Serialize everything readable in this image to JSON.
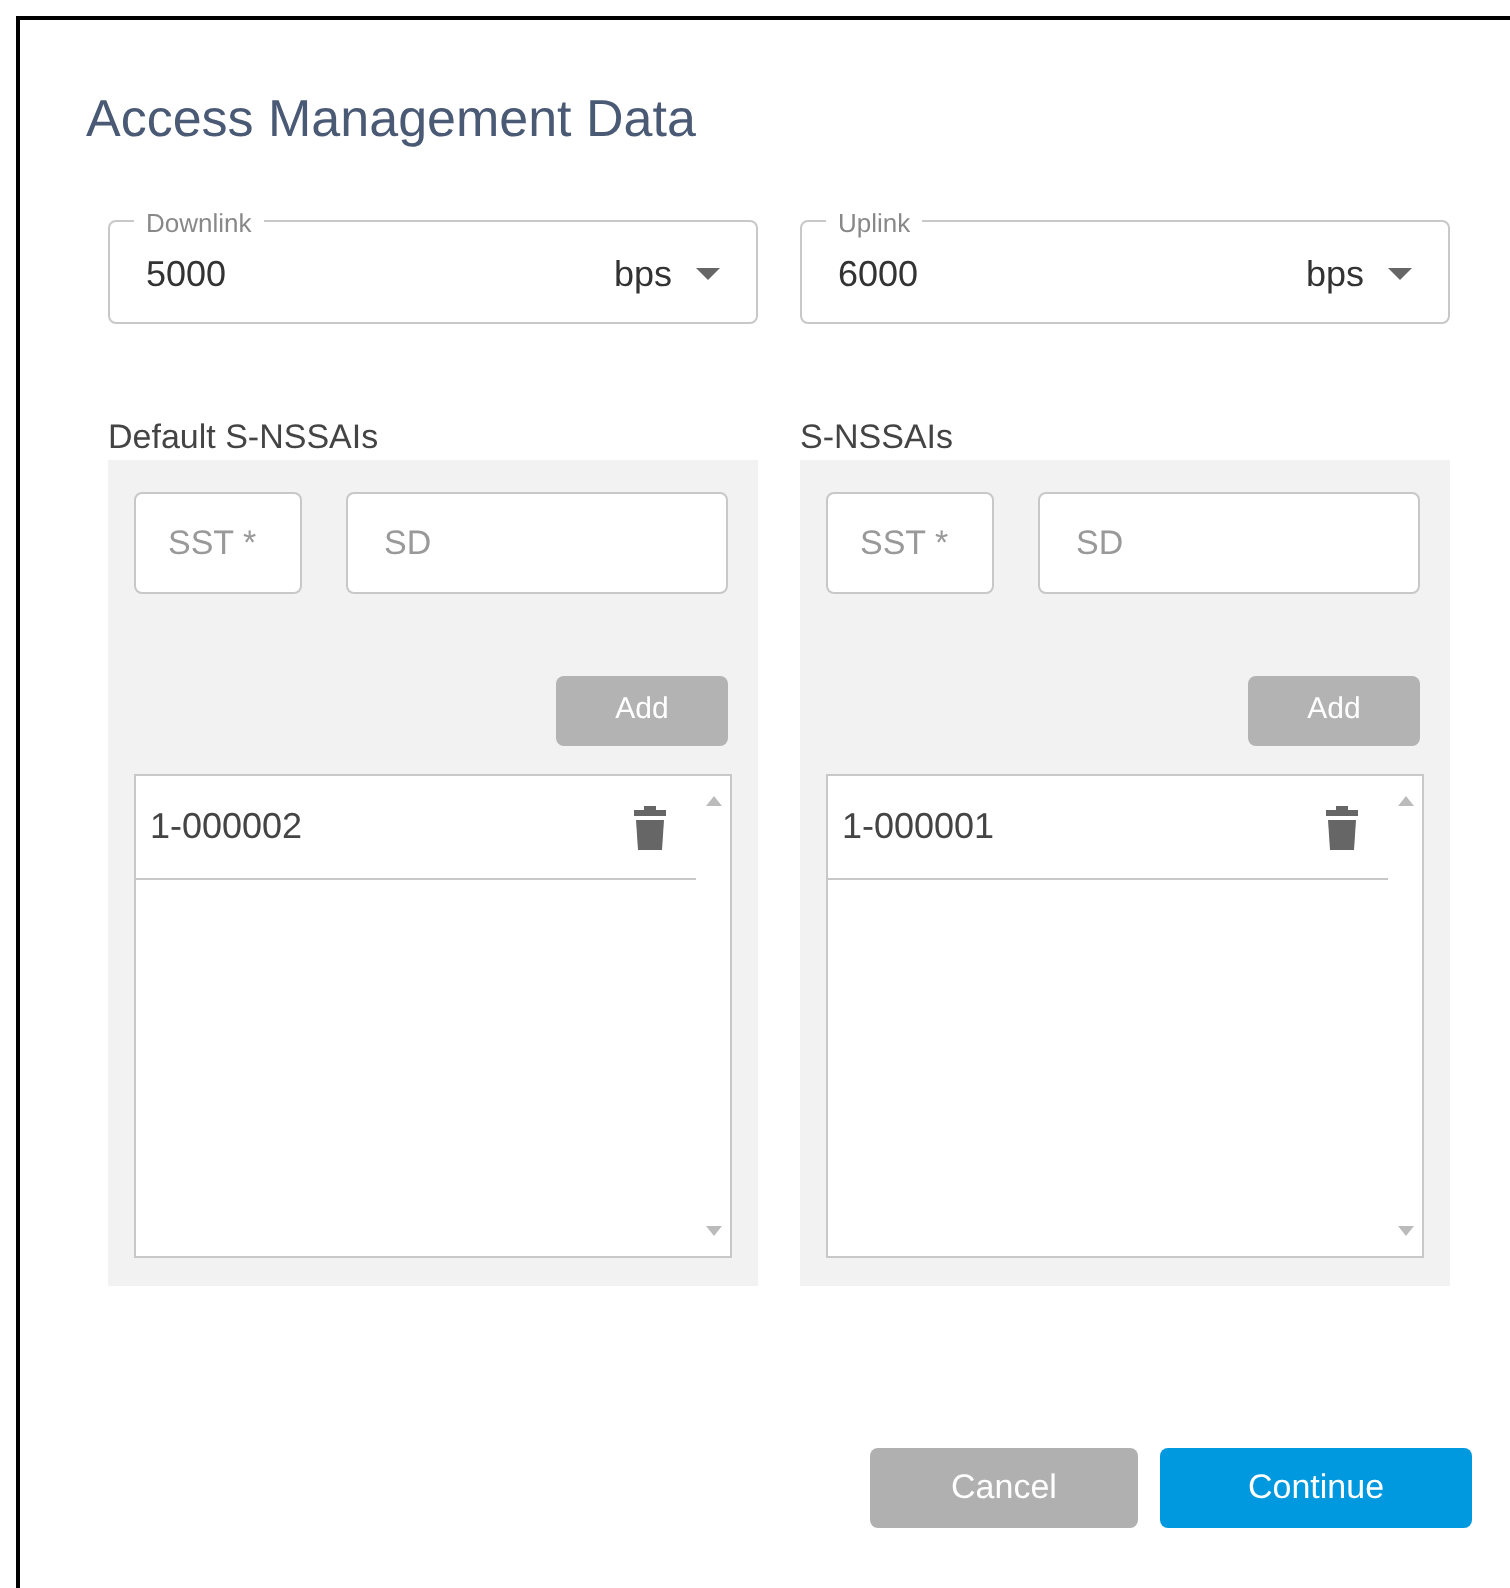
{
  "dialog": {
    "title": "Access Management Data"
  },
  "rates": [
    {
      "label": "Downlink",
      "value": "5000",
      "unit": "bps"
    },
    {
      "label": "Uplink",
      "value": "6000",
      "unit": "bps"
    }
  ],
  "sections": [
    {
      "title": "Default S-NSSAIs",
      "sst_placeholder": "SST *",
      "sd_placeholder": "SD",
      "add_button": {
        "label": "Add",
        "disabled": true
      },
      "items": [
        "1-000002"
      ]
    },
    {
      "title": "S-NSSAIs",
      "sst_placeholder": "SST *",
      "sd_placeholder": "SD",
      "add_button": {
        "label": "Add",
        "disabled": true
      },
      "items": [
        "1-000001"
      ]
    }
  ],
  "buttons": [
    {
      "label": "Cancel",
      "kind": "secondary"
    },
    {
      "label": "Continue",
      "kind": "primary"
    }
  ]
}
